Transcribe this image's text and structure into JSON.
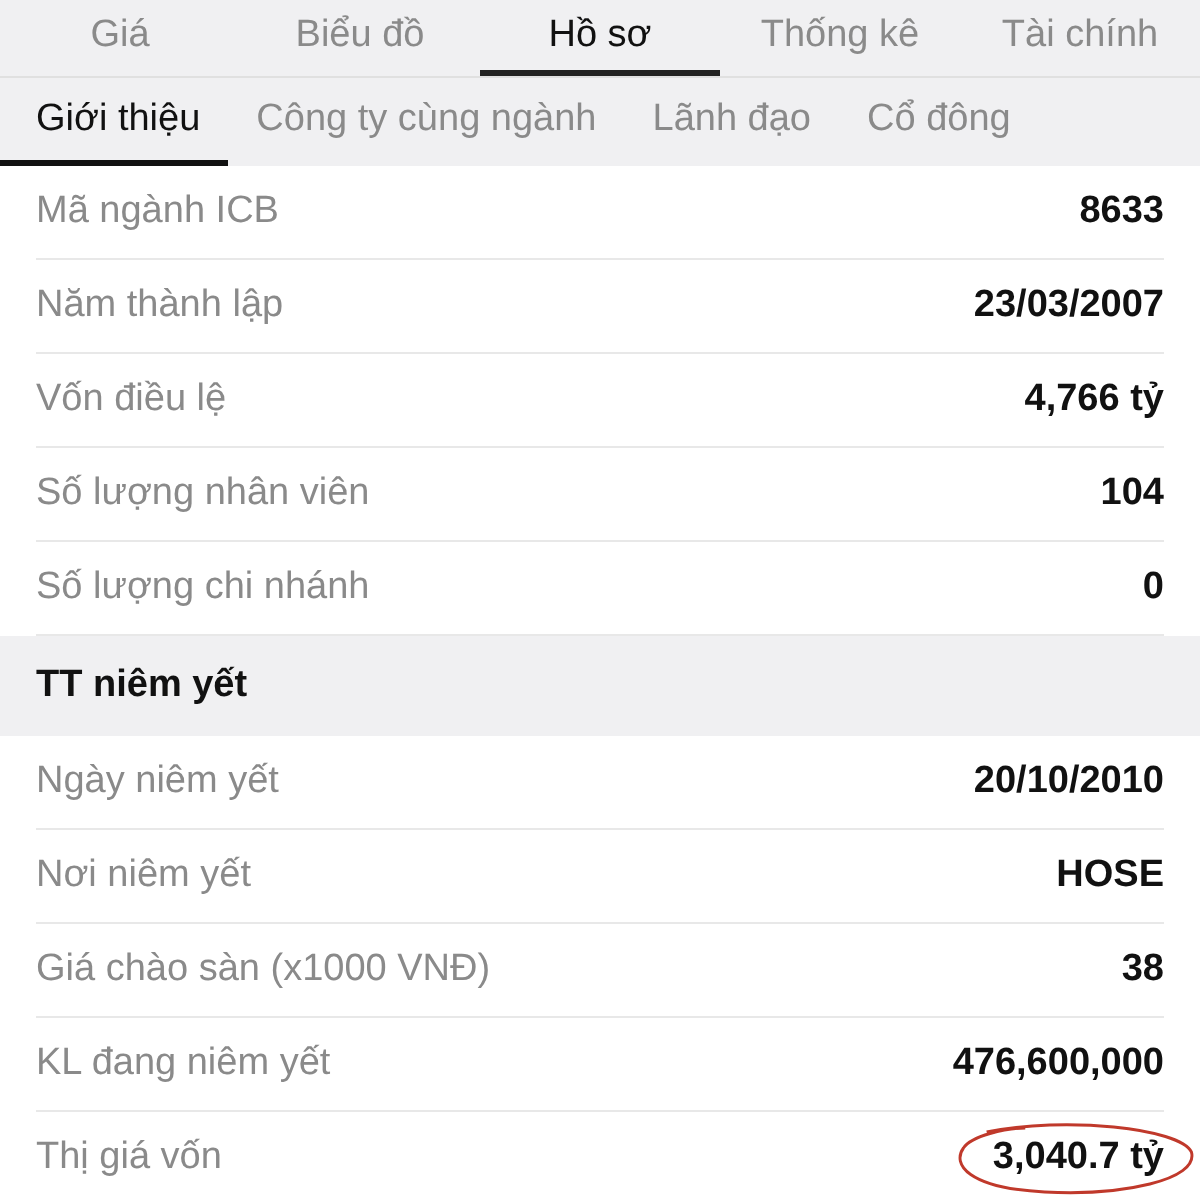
{
  "tabs": [
    {
      "label": "Giá",
      "selected": false
    },
    {
      "label": "Biểu đồ",
      "selected": false
    },
    {
      "label": "Hồ sơ",
      "selected": true
    },
    {
      "label": "Thống kê",
      "selected": false
    },
    {
      "label": "Tài chính",
      "selected": false
    }
  ],
  "subtabs": [
    {
      "label": "Giới thiệu",
      "selected": true
    },
    {
      "label": "Công ty cùng ngành",
      "selected": false
    },
    {
      "label": "Lãnh đạo",
      "selected": false
    },
    {
      "label": "Cổ đông",
      "selected": false
    }
  ],
  "rows": [
    {
      "kind": "item",
      "label": "Mã ngành ICB",
      "value": "8633"
    },
    {
      "kind": "item",
      "label": "Năm thành lập",
      "value": "23/03/2007"
    },
    {
      "kind": "item",
      "label": "Vốn điều lệ",
      "value": "4,766 tỷ"
    },
    {
      "kind": "item",
      "label": "Số lượng nhân viên",
      "value": "104"
    },
    {
      "kind": "item",
      "label": "Số lượng chi nhánh",
      "value": "0"
    },
    {
      "kind": "section",
      "label": "TT niêm yết"
    },
    {
      "kind": "item",
      "label": "Ngày niêm yết",
      "value": "20/10/2010"
    },
    {
      "kind": "item",
      "label": "Nơi niêm yết",
      "value": "HOSE"
    },
    {
      "kind": "item",
      "label": "Giá chào sàn (x1000 VNĐ)",
      "value": "38"
    },
    {
      "kind": "item",
      "label": "KL đang niêm yết",
      "value": "476,600,000"
    },
    {
      "kind": "item",
      "label": "Thị giá vốn",
      "value": "3,040.7 tỷ",
      "circled": true
    }
  ]
}
